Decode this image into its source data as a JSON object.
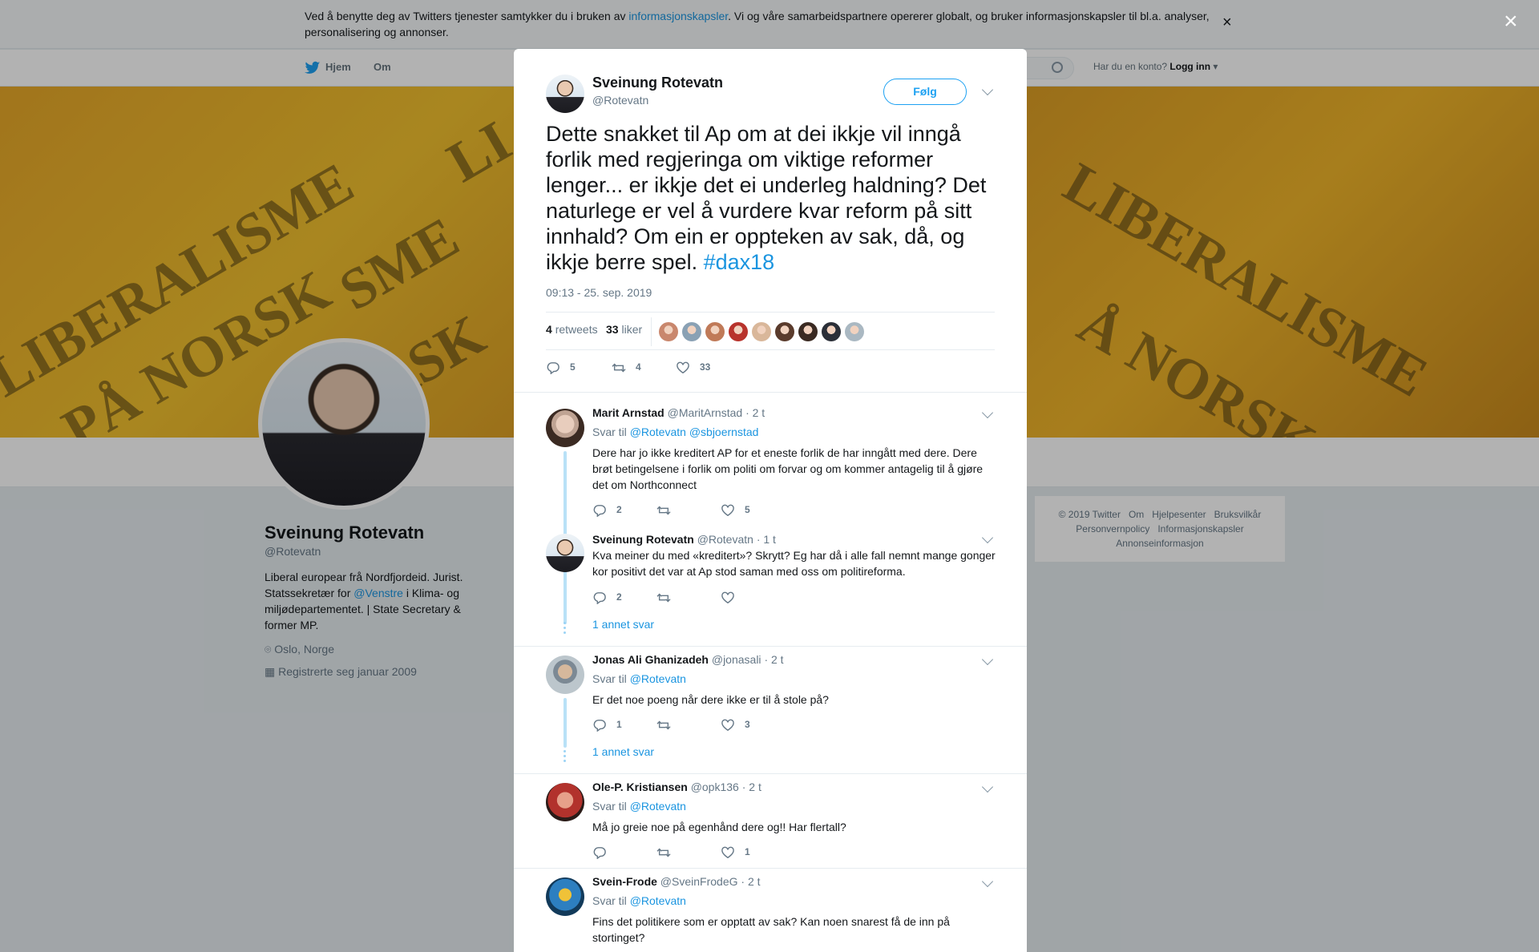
{
  "cookie": {
    "text_before": "Ved å benytte deg av Twitters tjenester samtykker du i bruken av ",
    "link": "informasjonskapsler",
    "text_after": ". Vi og våre samarbeidspartnere opererer globalt, og bruker informasjonskapsler til bl.a. analyser, personalisering og annonser.",
    "close": "×"
  },
  "nav": {
    "home": "Hjem",
    "about": "Om",
    "account_prompt": "Har du en konto?",
    "login": "Logg inn"
  },
  "banner_words": [
    "LIBERALISME",
    "PÅ NORSK",
    "SME",
    "RSK",
    "LIBERALISME",
    "Å NORSK",
    "LI"
  ],
  "profile": {
    "name": "Sveinung Rotevatn",
    "handle": "@Rotevatn",
    "bio_1": "Liberal europear frå Nordfjordeid. Jurist. Statssekretær for ",
    "bio_link": "@Venstre",
    "bio_2": " i Klima- og miljødepartementet. | State Secretary & former MP.",
    "location": "Oslo, Norge",
    "joined": "Registrerte seg januar 2009"
  },
  "footer": {
    "line1": [
      "© 2019 Twitter",
      "Om",
      "Hjelpesenter",
      "Bruksvilkår"
    ],
    "line2": [
      "Personvernpolicy",
      "Informasjonskapsler"
    ],
    "line3": [
      "Annonseinformasjon"
    ]
  },
  "overlay_close": "×",
  "tweet": {
    "author_name": "Sveinung Rotevatn",
    "author_handle": "@Rotevatn",
    "follow_label": "Følg",
    "text": "Dette snakket til Ap om at dei ikkje vil inngå forlik med regjeringa om viktige reformer lenger... er ikkje det ei underleg haldning? Det naturlege er vel å vurdere kvar reform på sitt innhald? Om ein er oppteken av sak, då, og ikkje berre spel. ",
    "hashtag": "#dax18",
    "timestamp": "09:13 - 25. sep. 2019",
    "retweets_count": "4",
    "retweets_label": "retweets",
    "likes_count": "33",
    "likes_label": "liker",
    "liker_colors": [
      "#c9876d",
      "#8aa1b4",
      "#c07a58",
      "#b8332c",
      "#d9b79a",
      "#5a3b2c",
      "#3a2a22",
      "#2b2f38",
      "#aab8c2"
    ],
    "action_replies": "5",
    "action_retweets": "4",
    "action_likes": "33"
  },
  "replies": [
    {
      "name": "Marit Arnstad",
      "handle": "@MaritArnstad",
      "time": "· 2 t",
      "reply_to_label": "Svar til",
      "reply_to": "@Rotevatn @sbjoernstad",
      "text": "Dere har jo ikke kreditert AP for et eneste forlik de har inngått med dere. Dere brøt betingelsene i forlik om politi om  forvar og om kommer antagelig til å gjøre det om Northconnect",
      "replies": "2",
      "retweets": "",
      "likes": "5",
      "avatar_color": "#d8c2b4"
    },
    {
      "name": "Sveinung Rotevatn",
      "handle": "@Rotevatn",
      "time": "· 1 t",
      "text": "Kva meiner du med «kreditert»? Skrytt? Eg har då i alle fall nemnt mange gonger kor positivt det var at Ap stod saman med oss om politireforma.",
      "replies": "2",
      "retweets": "",
      "likes": "",
      "more": "1 annet svar"
    },
    {
      "name": "Jonas Ali Ghanizadeh",
      "handle": "@jonasali",
      "time": "· 2 t",
      "reply_to_label": "Svar til",
      "reply_to": "@Rotevatn",
      "text": "Er det noe poeng når dere ikke er til å stole på?",
      "replies": "1",
      "retweets": "",
      "likes": "3",
      "more": "1 annet svar",
      "avatar_color": "#8e9aa3"
    },
    {
      "name": "Ole-P. Kristiansen",
      "handle": "@opk136",
      "time": "· 2 t",
      "reply_to_label": "Svar til",
      "reply_to": "@Rotevatn",
      "text": "Må jo greie noe på egenhånd dere og!! Har flertall?",
      "replies": "",
      "retweets": "",
      "likes": "1",
      "avatar_color": "#b2322c"
    },
    {
      "name": "Svein-Frode",
      "handle": "@SveinFrodeG",
      "time": "· 2 t",
      "reply_to_label": "Svar til",
      "reply_to": "@Rotevatn",
      "text": "Fins det politikere som er opptatt av sak? Kan noen snarest få de inn på stortinget?",
      "avatar_color": "#2d7fc0"
    }
  ]
}
